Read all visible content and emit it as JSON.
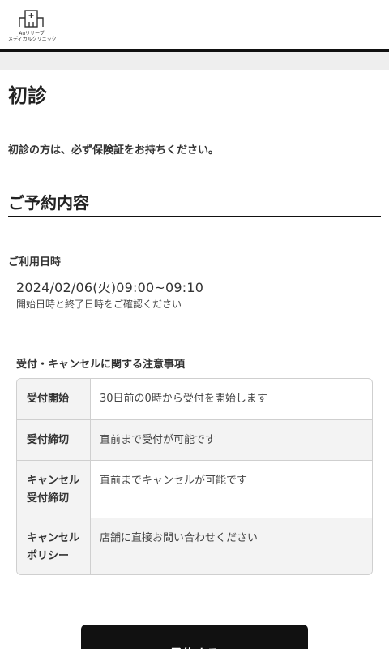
{
  "header": {
    "logo_text_line1": "Auリサーブ",
    "logo_text_line2": "メディカルクリニック"
  },
  "page": {
    "title": "初診",
    "notice": "初診の方は、必ず保険証をお持ちください。"
  },
  "reservation": {
    "section_title": "ご予約内容",
    "date_label": "ご利用日時",
    "date_value": "2024/02/06(火)09:00~09:10",
    "date_note": "開始日時と終了日時をご確認ください"
  },
  "policy": {
    "title": "受付・キャンセルに関する注意事項",
    "rows": [
      {
        "head_line1": "受付開始",
        "head_line2": "",
        "value": "30日前の0時から受付を開始します"
      },
      {
        "head_line1": "受付締切",
        "head_line2": "",
        "value": "直前まで受付が可能です"
      },
      {
        "head_line1": "キャンセル",
        "head_line2": "受付締切",
        "value": "直前までキャンセルが可能です"
      },
      {
        "head_line1": "キャンセル",
        "head_line2": "ポリシー",
        "value": "店舗に直接お問い合わせください"
      }
    ]
  },
  "actions": {
    "reserve_label": "予約する"
  },
  "colors": {
    "primary_button": "#111111",
    "divider": "#111111",
    "table_header_bg": "#f3f3f3",
    "strip_bg": "#eeeeee"
  }
}
